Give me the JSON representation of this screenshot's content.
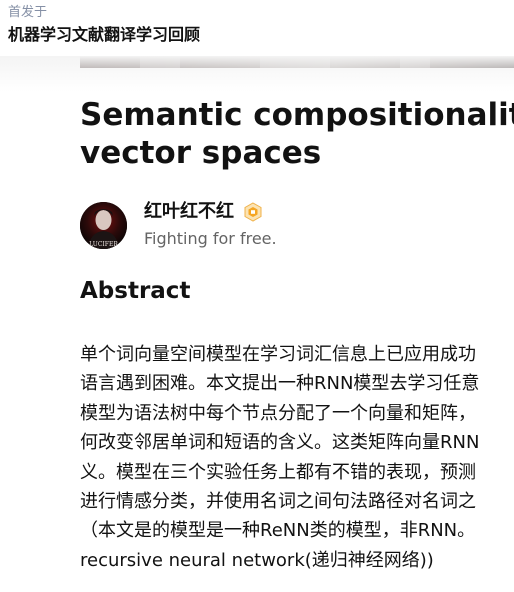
{
  "header": {
    "first_published": "首发于",
    "column_name": "机器学习文献翻译学习回顾"
  },
  "article": {
    "title_line_1": "Semantic compositionality th",
    "title_line_2": "vector spaces"
  },
  "author": {
    "name": "红叶红不红",
    "bio": "Fighting for free.",
    "avatar_text": "LUCIFER",
    "badge_icon": "hexagon-badge-icon",
    "badge_color": "#f5a623"
  },
  "content": {
    "section_heading": "Abstract",
    "lines": [
      "单个词向量空间模型在学习词汇信息上已应用成功",
      "语言遇到困难。本文提出一种RNN模型去学习任意",
      "模型为语法树中每个节点分配了一个向量和矩阵，",
      "何改变邻居单词和短语的含义。这类矩阵向量RNN",
      "义。模型在三个实验任务上都有不错的表现，预测",
      "进行情感分类，并使用名词之间句法路径对名词之",
      "（本文是的模型是一种ReNN类的模型，非RNN。",
      "recursive neural network(递归神经网络))"
    ]
  }
}
